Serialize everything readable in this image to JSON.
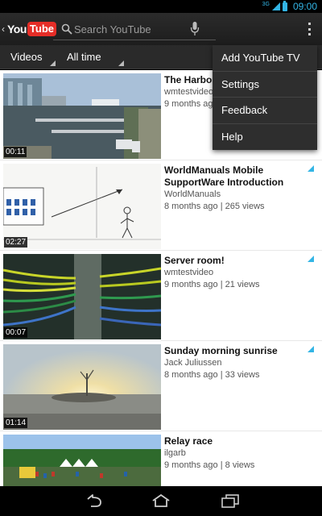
{
  "status_bar": {
    "network": "3G",
    "time": "09:00"
  },
  "action_bar": {
    "logo": {
      "you": "You",
      "tube": "Tube"
    },
    "search_placeholder": "Search YouTube",
    "icons": [
      "back-chevron-icon",
      "search-icon",
      "microphone-icon",
      "overflow-menu-icon"
    ]
  },
  "filters": {
    "type": "Videos",
    "time": "All time"
  },
  "menu": {
    "items": [
      "Add YouTube TV",
      "Settings",
      "Feedback",
      "Help"
    ]
  },
  "videos": [
    {
      "title": "The Harbour",
      "uploader": "wmtestvideo",
      "age": "9 months ago",
      "views": "",
      "duration": "00:11",
      "thumb_colors": [
        "#9fb7d0",
        "#587080",
        "#3c4a4f"
      ]
    },
    {
      "title": "WorldManuals Mobile SupportWare Introduction",
      "uploader": "WorldManuals",
      "age": "8 months ago",
      "views": "265 views",
      "duration": "02:27",
      "thumb_colors": [
        "#f4f4f4",
        "#2d5fa8"
      ]
    },
    {
      "title": "Server room!",
      "uploader": "wmtestvideo",
      "age": "9 months ago",
      "views": "21 views",
      "duration": "00:07",
      "thumb_colors": [
        "#c4d326",
        "#2f8a4a",
        "#3a6fc4"
      ]
    },
    {
      "title": "Sunday morning sunrise",
      "uploader": "Jack Juliussen",
      "age": "8 months ago",
      "views": "33 views",
      "duration": "01:14",
      "thumb_colors": [
        "#c9d2d8",
        "#f3e3a8",
        "#6a6a66"
      ]
    },
    {
      "title": "Relay race",
      "uploader": "ilgarb",
      "age": "9 months ago",
      "views": "8 views",
      "duration": "",
      "thumb_colors": [
        "#8fb8e4",
        "#2f6a2a",
        "#ffffff"
      ]
    }
  ],
  "nav_bar": {
    "icons": [
      "back-icon",
      "home-icon",
      "recent-apps-icon"
    ]
  },
  "colors": {
    "accent": "#33b5e5",
    "logo_red": "#e52d27",
    "actionbar": "#222222",
    "menu_bg": "#2e2e2e"
  }
}
